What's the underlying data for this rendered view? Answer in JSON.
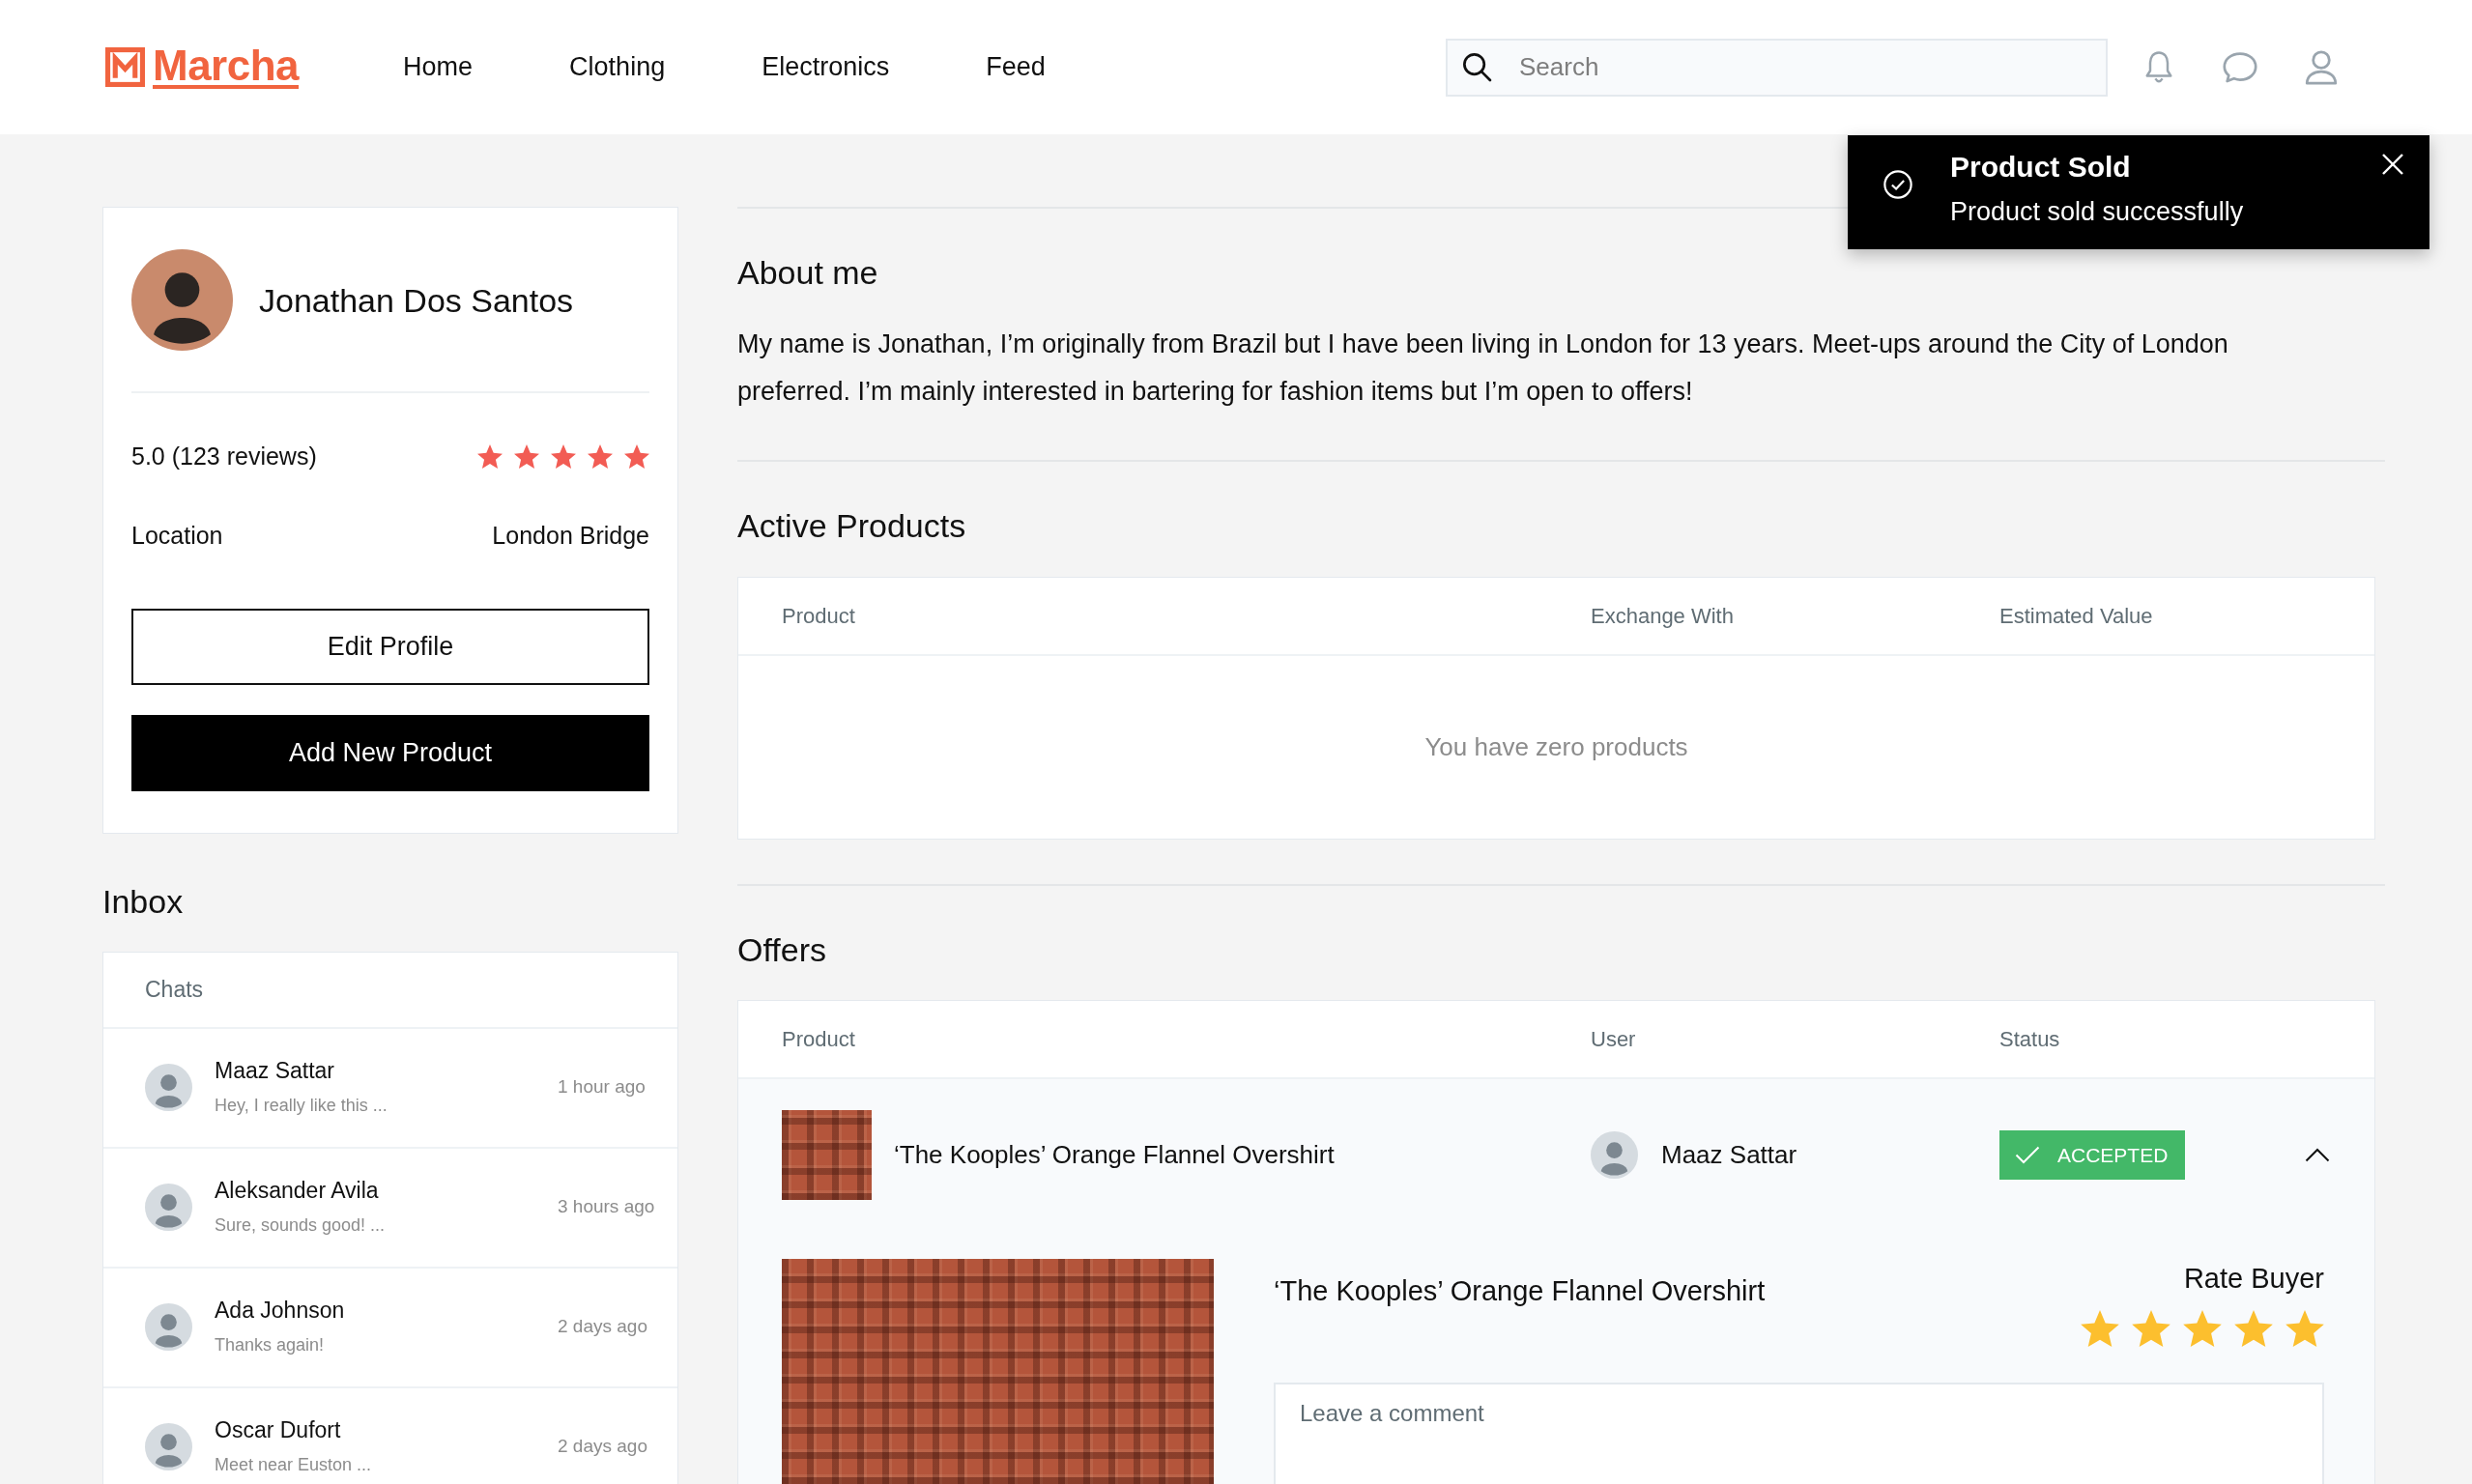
{
  "header": {
    "logo": {
      "text": "Marcha"
    },
    "nav": [
      {
        "label": "Home"
      },
      {
        "label": "Clothing"
      },
      {
        "label": "Electronics"
      },
      {
        "label": "Feed"
      }
    ],
    "search": {
      "placeholder": "Search"
    }
  },
  "toast": {
    "title": "Product Sold",
    "message": "Product sold successfully"
  },
  "profile": {
    "name": "Jonathan Dos Santos",
    "rating": "5.0 (123 reviews)",
    "stars": 5,
    "location_label": "Location",
    "location": "London Bridge",
    "buttons": [
      {
        "label": "Edit Profile",
        "kind": "outline"
      },
      {
        "label": "Add New Product",
        "kind": "solid"
      }
    ]
  },
  "inbox": {
    "title": "Inbox",
    "header": "Chats",
    "chats": [
      {
        "name": "Maaz Sattar",
        "preview": "Hey, I really like this ...",
        "time": "1 hour ago"
      },
      {
        "name": "Aleksander Avila",
        "preview": "Sure, sounds good! ...",
        "time": "3 hours ago"
      },
      {
        "name": "Ada Johnson",
        "preview": "Thanks again!",
        "time": "2 days ago"
      },
      {
        "name": "Oscar Dufort",
        "preview": "Meet near Euston ...",
        "time": "2 days ago"
      }
    ]
  },
  "about": {
    "title": "About me",
    "text": "My name is Jonathan, I’m originally from Brazil but I have been living in London for 13 years. Meet-ups around the City of London preferred. I’m mainly interested in bartering for fashion items but I’m open to offers!"
  },
  "active_products": {
    "title": "Active Products",
    "columns": [
      "Product",
      "Exchange With",
      "Estimated Value"
    ],
    "empty_text": "You have zero products"
  },
  "offers": {
    "title": "Offers",
    "columns": [
      "Product",
      "User",
      "Status"
    ],
    "rows": [
      {
        "product": "‘The Kooples’ Orange Flannel Overshirt",
        "user": "Maaz Sattar",
        "status": {
          "kind": "accepted",
          "label": "ACCEPTED"
        },
        "expanded": true,
        "detail": {
          "title": "‘The Kooples’ Orange Flannel Overshirt",
          "rate_label": "Rate Buyer",
          "stars": 5,
          "comment": {
            "placeholder": "Leave a comment"
          }
        }
      }
    ]
  }
}
